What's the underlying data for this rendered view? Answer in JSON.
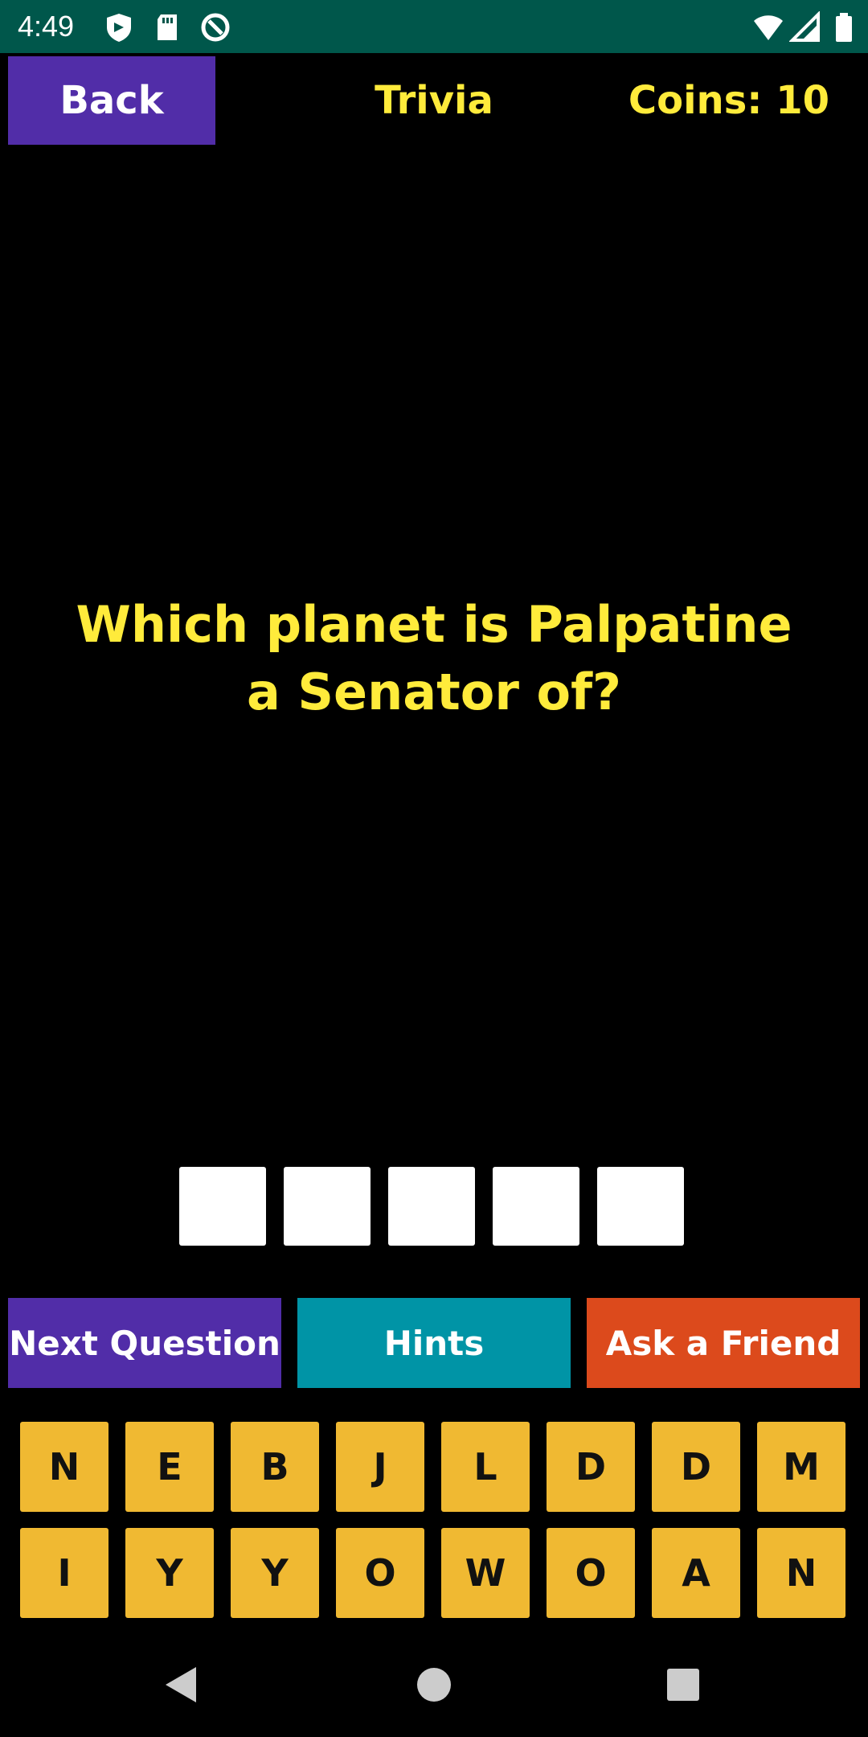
{
  "status_bar": {
    "time": "4:49",
    "icons": [
      "shield-icon",
      "sd-card-icon",
      "sync-icon",
      "wifi-icon",
      "signal-icon",
      "battery-icon"
    ],
    "background_color": "#00574b"
  },
  "header": {
    "back_label": "Back",
    "title": "Trivia",
    "coins_label": "Coins: 10",
    "back_color": "#512da8",
    "text_color": "#ffeb3b"
  },
  "question": {
    "text": "Which planet is Palpatine a Senator of?"
  },
  "answer": {
    "slots": [
      "",
      "",
      "",
      "",
      ""
    ]
  },
  "actions": {
    "next_label": "Next Question",
    "hints_label": "Hints",
    "ask_label": "Ask a Friend",
    "next_color": "#512da8",
    "hints_color": "#0094a6",
    "ask_color": "#dc4a1c"
  },
  "letters": {
    "row1": [
      "N",
      "E",
      "B",
      "J",
      "L",
      "D",
      "D",
      "M"
    ],
    "row2": [
      "I",
      "Y",
      "Y",
      "O",
      "W",
      "O",
      "A",
      "N"
    ],
    "key_color": "#f0b932"
  },
  "nav_bar": {
    "icons": [
      "back-triangle-icon",
      "home-circle-icon",
      "recents-square-icon"
    ]
  }
}
